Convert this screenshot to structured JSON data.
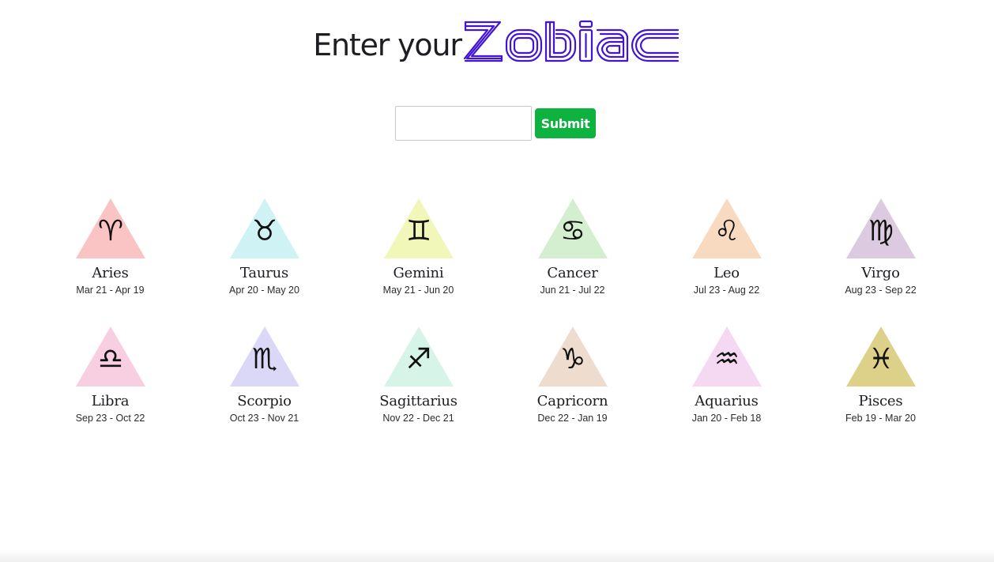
{
  "header": {
    "title_prefix": "Enter your",
    "logo_text": "ZODIAC",
    "logo_color": "#4114d8"
  },
  "form": {
    "input_value": "",
    "input_placeholder": "",
    "submit_label": "Submit",
    "submit_color": "#0eb23f"
  },
  "signs": [
    {
      "name": "Aries",
      "dates": "Mar 21 - Apr 19",
      "color": "#fbc4c4",
      "icon": "aries-icon",
      "glyph": "♈"
    },
    {
      "name": "Taurus",
      "dates": "Apr 20 - May 20",
      "color": "#cff2f5",
      "icon": "taurus-icon",
      "glyph": "♉"
    },
    {
      "name": "Gemini",
      "dates": "May 21 - Jun 20",
      "color": "#f0f7b8",
      "icon": "gemini-icon",
      "glyph": "♊"
    },
    {
      "name": "Cancer",
      "dates": "Jun 21 - Jul 22",
      "color": "#d3efcf",
      "icon": "cancer-icon",
      "glyph": "♋"
    },
    {
      "name": "Leo",
      "dates": "Jul 23 - Aug 22",
      "color": "#f7dac0",
      "icon": "leo-icon",
      "glyph": "♌"
    },
    {
      "name": "Virgo",
      "dates": "Aug 23 - Sep 22",
      "color": "#dccbe0",
      "icon": "virgo-icon",
      "glyph": "♍"
    },
    {
      "name": "Libra",
      "dates": "Sep 23 - Oct 22",
      "color": "#f7cfe0",
      "icon": "libra-icon",
      "glyph": "♎"
    },
    {
      "name": "Scorpio",
      "dates": "Oct 23 - Nov 21",
      "color": "#dad8f6",
      "icon": "scorpio-icon",
      "glyph": "♏"
    },
    {
      "name": "Sagittarius",
      "dates": "Nov 22 - Dec 21",
      "color": "#d6f4e8",
      "icon": "sagittarius-icon",
      "glyph": "♐"
    },
    {
      "name": "Capricorn",
      "dates": "Dec 22 - Jan 19",
      "color": "#eeddce",
      "icon": "capricorn-icon",
      "glyph": "♑"
    },
    {
      "name": "Aquarius",
      "dates": "Jan 20 - Feb 18",
      "color": "#f5d9f3",
      "icon": "aquarius-icon",
      "glyph": "♒"
    },
    {
      "name": "Pisces",
      "dates": "Feb 19 - Mar 20",
      "color": "#ddd18a",
      "icon": "pisces-icon",
      "glyph": "♓"
    }
  ]
}
